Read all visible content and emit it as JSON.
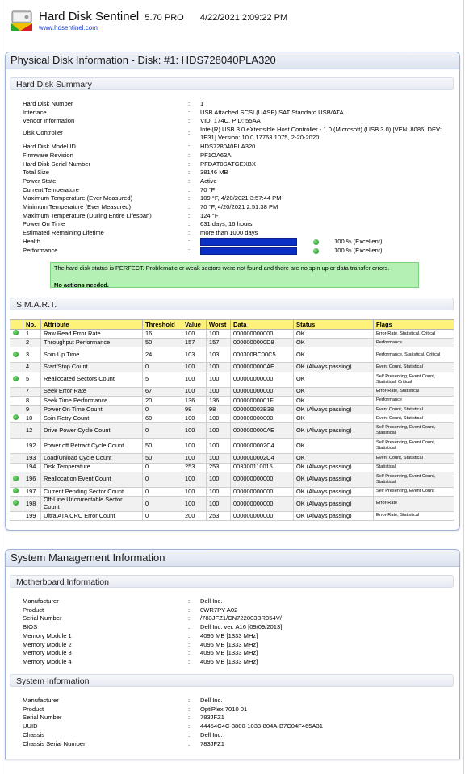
{
  "header": {
    "app_name": "Hard Disk Sentinel",
    "version": "5.70 PRO",
    "datetime": "4/22/2021 2:09:22 PM",
    "website": "www.hdsentinel.com"
  },
  "disk": {
    "title": "Physical Disk Information - Disk: #1: HDS728040PLA320",
    "summary_heading": "Hard Disk Summary",
    "summary": [
      {
        "k": "Hard Disk Number",
        "v": "1"
      },
      {
        "k": "Interface",
        "v": "USB Attached SCSI (UASP) SAT Standard USB/ATA"
      },
      {
        "k": "Vendor Information",
        "v": "VID: 174C, PID: 55AA"
      },
      {
        "k": "Disk Controller",
        "v": "Intel(R) USB 3.0 eXtensible Host Controller - 1.0 (Microsoft) (USB 3.0) [VEN: 8086, DEV: 1E31] Version: 10.0.17763.1075, 2-20-2020"
      },
      {
        "k": "Hard Disk Model ID",
        "v": "HDS728040PLA320"
      },
      {
        "k": "Firmware Revision",
        "v": "PF1OA63A"
      },
      {
        "k": "Hard Disk Serial Number",
        "v": "PFDAT0SATGEXBX"
      },
      {
        "k": "Total Size",
        "v": "38146 MB"
      },
      {
        "k": "Power State",
        "v": "Active"
      },
      {
        "k": "Current Temperature",
        "v": "70 °F"
      },
      {
        "k": "Maximum Temperature (Ever Measured)",
        "v": "109 °F, 4/20/2021 3:57:44 PM"
      },
      {
        "k": "Minimum Temperature (Ever Measured)",
        "v": "70 °F, 4/20/2021 2:51:38 PM"
      },
      {
        "k": "Maximum Temperature (During Entire Lifespan)",
        "v": "124 °F"
      },
      {
        "k": "Power On Time",
        "v": "631 days, 16 hours"
      },
      {
        "k": "Estimated Remaining Lifetime",
        "v": "more than 1000 days"
      }
    ],
    "health_label": "Health",
    "health_text": "100 % (Excellent)",
    "health_value": 100,
    "performance_label": "Performance",
    "performance_text": "100 % (Excellent)",
    "performance_value": 100,
    "status_line1": "The hard disk status is PERFECT. Problematic or weak sectors were not found and there are no spin up or data transfer errors.",
    "status_line2": "No actions needed.",
    "smart_heading": "S.M.A.R.T.",
    "smart_columns": [
      "No.",
      "Attribute",
      "Threshold",
      "Value",
      "Worst",
      "Data",
      "Status",
      "Flags"
    ],
    "smart_rows": [
      {
        "mark": true,
        "no": "1",
        "attr": "Raw Read Error Rate",
        "thr": "16",
        "val": "100",
        "worst": "100",
        "data": "000000000000",
        "status": "OK",
        "flags": "Error-Rate, Statistical, Critical"
      },
      {
        "mark": false,
        "no": "2",
        "attr": "Throughput Performance",
        "thr": "50",
        "val": "157",
        "worst": "157",
        "data": "0000000000D8",
        "status": "OK",
        "flags": "Performance"
      },
      {
        "mark": true,
        "no": "3",
        "attr": "Spin Up Time",
        "thr": "24",
        "val": "103",
        "worst": "103",
        "data": "000300BC00C5",
        "status": "OK",
        "flags": "Performance, Statistical, Critical",
        "tall": true
      },
      {
        "mark": false,
        "no": "4",
        "attr": "Start/Stop Count",
        "thr": "0",
        "val": "100",
        "worst": "100",
        "data": "0000000000AE",
        "status": "OK (Always passing)",
        "flags": "Event Count, Statistical"
      },
      {
        "mark": true,
        "no": "5",
        "attr": "Reallocated Sectors Count",
        "thr": "5",
        "val": "100",
        "worst": "100",
        "data": "000000000000",
        "status": "OK",
        "flags": "Self Preserving, Event Count, Statistical, Critical",
        "tall": true
      },
      {
        "mark": false,
        "no": "7",
        "attr": "Seek Error Rate",
        "thr": "67",
        "val": "100",
        "worst": "100",
        "data": "000000000000",
        "status": "OK",
        "flags": "Error-Rate, Statistical"
      },
      {
        "mark": false,
        "no": "8",
        "attr": "Seek Time Performance",
        "thr": "20",
        "val": "136",
        "worst": "136",
        "data": "00000000001F",
        "status": "OK",
        "flags": "Performance"
      },
      {
        "mark": false,
        "no": "9",
        "attr": "Power On Time Count",
        "thr": "0",
        "val": "98",
        "worst": "98",
        "data": "000000003B38",
        "status": "OK (Always passing)",
        "flags": "Event Count, Statistical"
      },
      {
        "mark": true,
        "no": "10",
        "attr": "Spin Retry Count",
        "thr": "60",
        "val": "100",
        "worst": "100",
        "data": "000000000000",
        "status": "OK",
        "flags": "Event Count, Statistical"
      },
      {
        "mark": false,
        "no": "12",
        "attr": "Drive Power Cycle Count",
        "thr": "0",
        "val": "100",
        "worst": "100",
        "data": "0000000000AE",
        "status": "OK (Always passing)",
        "flags": "Self Preserving, Event Count, Statistical",
        "tall": true
      },
      {
        "mark": false,
        "no": "192",
        "attr": "Power off Retract Cycle Count",
        "thr": "50",
        "val": "100",
        "worst": "100",
        "data": "0000000002C4",
        "status": "OK",
        "flags": "Self Preserving, Event Count, Statistical",
        "tall": true
      },
      {
        "mark": false,
        "no": "193",
        "attr": "Load/Unload Cycle Count",
        "thr": "50",
        "val": "100",
        "worst": "100",
        "data": "0000000002C4",
        "status": "OK",
        "flags": "Event Count, Statistical"
      },
      {
        "mark": false,
        "no": "194",
        "attr": "Disk Temperature",
        "thr": "0",
        "val": "253",
        "worst": "253",
        "data": "003300110015",
        "status": "OK (Always passing)",
        "flags": "Statistical"
      },
      {
        "mark": true,
        "no": "196",
        "attr": "Reallocation Event Count",
        "thr": "0",
        "val": "100",
        "worst": "100",
        "data": "000000000000",
        "status": "OK (Always passing)",
        "flags": "Self Preserving, Event Count, Statistical",
        "tall": true
      },
      {
        "mark": true,
        "no": "197",
        "attr": "Current Pending Sector Count",
        "thr": "0",
        "val": "100",
        "worst": "100",
        "data": "000000000000",
        "status": "OK (Always passing)",
        "flags": "Self Preserving, Event Count"
      },
      {
        "mark": true,
        "no": "198",
        "attr": "Off-Line Uncorrectable Sector Count",
        "thr": "0",
        "val": "100",
        "worst": "100",
        "data": "000000000000",
        "status": "OK (Always passing)",
        "flags": "Error-Rate",
        "tall": true
      },
      {
        "mark": false,
        "no": "199",
        "attr": "Ultra ATA CRC Error Count",
        "thr": "0",
        "val": "200",
        "worst": "253",
        "data": "000000000000",
        "status": "OK (Always passing)",
        "flags": "Error-Rate, Statistical"
      }
    ]
  },
  "system": {
    "title": "System Management Information",
    "motherboard_heading": "Motherboard Information",
    "motherboard": [
      {
        "k": "Manufacturer",
        "v": "Dell Inc."
      },
      {
        "k": "Product",
        "v": "0WR7PY A02"
      },
      {
        "k": "Serial Number",
        "v": "/783JFZ1/CN722003BR054V/"
      },
      {
        "k": "BIOS",
        "v": "Dell Inc. ver. A16 [09/09/2013]"
      },
      {
        "k": "Memory Module 1",
        "v": "4096 MB [1333 MHz]"
      },
      {
        "k": "Memory Module 2",
        "v": "4096 MB [1333 MHz]"
      },
      {
        "k": "Memory Module 3",
        "v": "4096 MB [1333 MHz]"
      },
      {
        "k": "Memory Module 4",
        "v": "4096 MB [1333 MHz]"
      }
    ],
    "sysinfo_heading": "System Information",
    "sysinfo": [
      {
        "k": "Manufacturer",
        "v": "Dell Inc."
      },
      {
        "k": "Product",
        "v": "OptiPlex 7010 01"
      },
      {
        "k": "Serial Number",
        "v": "783JFZ1"
      },
      {
        "k": "UUID",
        "v": "44454C4C-3800-1033-804A-B7C04F465A31"
      },
      {
        "k": "Chassis",
        "v": "Dell Inc."
      },
      {
        "k": "Chassis Serial Number",
        "v": "783JFZ1"
      }
    ]
  },
  "colors": {
    "bar_fill": "#0a2fc4",
    "status_bg": "#b4f0b4",
    "table_header": "#fff27a",
    "ok_mark": "#1d8a1d"
  }
}
